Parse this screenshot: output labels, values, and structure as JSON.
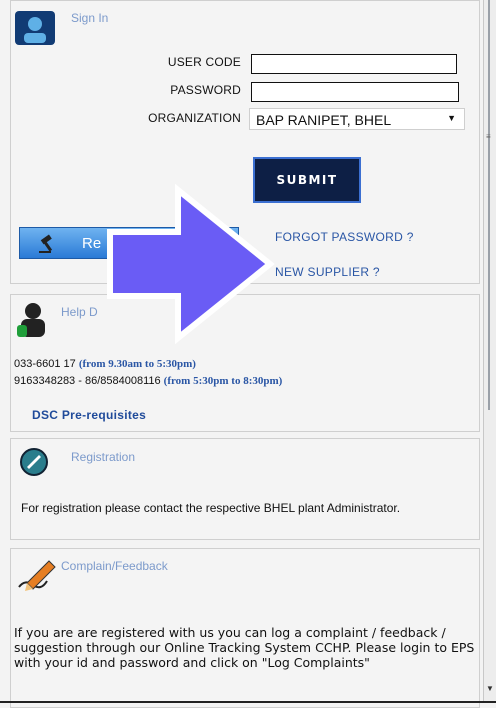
{
  "signin": {
    "title": "Sign In",
    "user_code_label": "USER CODE",
    "user_code_value": "",
    "password_label": "PASSWORD",
    "password_value": "",
    "organization_label": "ORGANIZATION",
    "organization_value": "BAP RANIPET, BHEL",
    "submit_label": "SUBMIT",
    "reverse_label": "Re",
    "forgot_label": "FORGOT PASSWORD ?",
    "new_supplier_label": "NEW SUPPLIER ?"
  },
  "help": {
    "title": "Help D",
    "line1_number": "033-6601 17",
    "line1_time": "(from 9.30am to 5:30pm)",
    "line2_number": "9163348283 - 86/8584008116",
    "line2_time": "(from 5:30pm to 8:30pm)",
    "dsc_link": "DSC Pre-requisites"
  },
  "registration": {
    "title": "Registration",
    "text": "For registration please contact the respective BHEL plant Administrator."
  },
  "complain": {
    "title": "Complain/Feedback",
    "text": "If you are are registered with us you can log a complaint / feedback / suggestion through our Online Tracking System CCHP. Please login to EPS with your id and password and click on \"Log Complaints\""
  },
  "colors": {
    "accent": "#7c9acb",
    "submit_bg": "#0d1f45",
    "overlay_arrow": "#6a5cf5"
  }
}
